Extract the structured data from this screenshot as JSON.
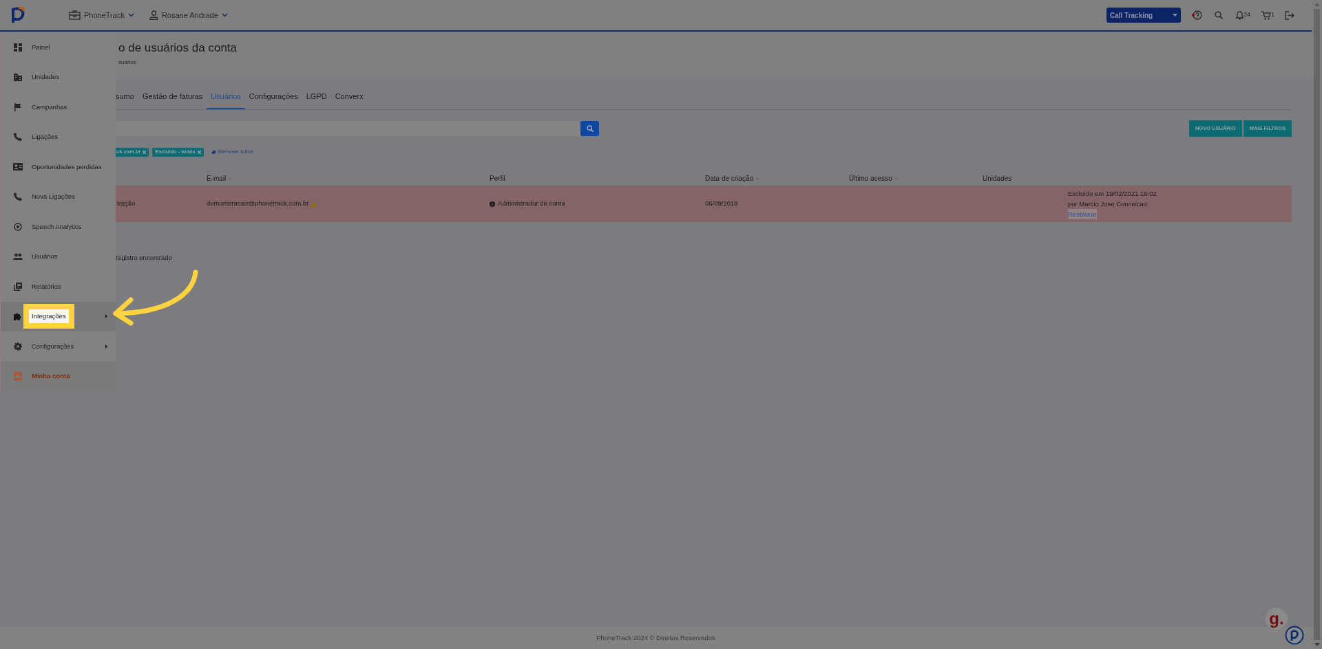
{
  "topbar": {
    "account_menu": "PhoneTrack",
    "user_menu": "Rosane Andrade",
    "product_select": "Call Tracking",
    "notifications_count": "34",
    "cart_count": "1"
  },
  "sidebar": {
    "items": [
      {
        "label": "Painel",
        "kind": "link",
        "selected": false,
        "highlighted": false
      },
      {
        "label": "Unidades",
        "kind": "link",
        "selected": false,
        "highlighted": false
      },
      {
        "label": "Campanhas",
        "kind": "link",
        "selected": false,
        "highlighted": false
      },
      {
        "label": "Ligações",
        "kind": "link",
        "selected": false,
        "highlighted": false
      },
      {
        "label": "Oportunidades perdidas",
        "kind": "link",
        "selected": false,
        "highlighted": false
      },
      {
        "label": "Nova Ligações",
        "kind": "link",
        "selected": false,
        "highlighted": false
      },
      {
        "label": "Speech Analytics",
        "kind": "link",
        "selected": false,
        "highlighted": false
      },
      {
        "label": "Usuários",
        "kind": "link",
        "selected": false,
        "highlighted": false
      },
      {
        "label": "Relatórios",
        "kind": "link",
        "selected": false,
        "highlighted": false
      },
      {
        "label": "Integrações",
        "kind": "submenu",
        "selected": false,
        "highlighted": true
      },
      {
        "label": "Configurações",
        "kind": "submenu",
        "selected": false,
        "highlighted": false
      },
      {
        "label": "Minha conta",
        "kind": "link",
        "selected": true,
        "highlighted": false
      }
    ]
  },
  "page": {
    "title": "o de usuários da conta",
    "breadcrumb": "suários"
  },
  "tabs": [
    {
      "label": "sumo",
      "selected": false
    },
    {
      "label": "Gestão de faturas",
      "selected": false
    },
    {
      "label": "Usuários",
      "selected": true
    },
    {
      "label": "Configurações",
      "selected": false
    },
    {
      "label": "LGPD",
      "selected": false
    },
    {
      "label": "Converx",
      "selected": false
    }
  ],
  "filters": {
    "chips": [
      "ck.com.br",
      "Excluído - todos"
    ],
    "clear": "Remover todos"
  },
  "buttons": [
    "NOVO USUÁRIO",
    "MAIS FILTROS"
  ],
  "table": {
    "columns": [
      {
        "label": "E-mail",
        "sortable": true
      },
      {
        "label": "Perfil",
        "sortable": false
      },
      {
        "label": "Data de criação",
        "sortable": true
      },
      {
        "label": "Último acesso",
        "sortable": true
      },
      {
        "label": "Unidades",
        "sortable": false
      }
    ],
    "rows": [
      {
        "deleted": true,
        "name": "tração",
        "email": "demonstracao@phonetrack.com.br",
        "email_warning": true,
        "profile": "Administrador de conta",
        "created": "06/09/2018",
        "deleted_at": "Excluído em 19/02/2021 16:02",
        "deleted_by": "por Marcio Jose Conceicao",
        "restore": "Restaurar"
      }
    ]
  },
  "result_count": "registro encontrado",
  "footer": "PhoneTrack 2024 © Direitos Reservados",
  "chat_badge": "g."
}
